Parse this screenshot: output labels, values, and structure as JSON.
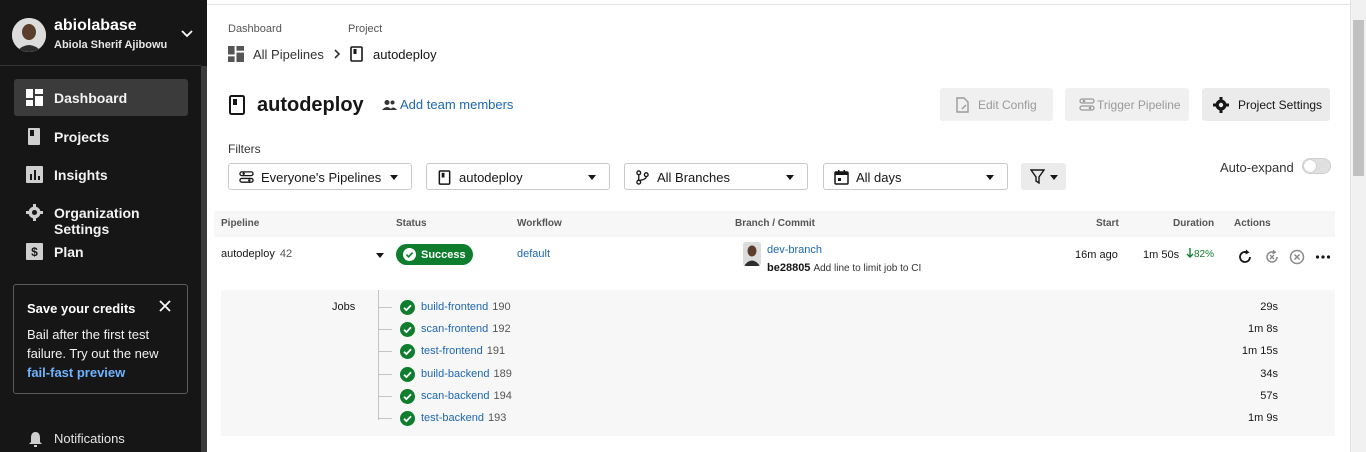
{
  "user": {
    "username": "abiolabase",
    "full_name": "Abiola Sherif Ajibowu"
  },
  "sidebar": {
    "items": [
      {
        "label": "Dashboard",
        "icon": "dashboard-icon",
        "active": true
      },
      {
        "label": "Projects",
        "icon": "projects-icon"
      },
      {
        "label": "Insights",
        "icon": "insights-icon"
      },
      {
        "label": "Organization Settings",
        "icon": "gear-icon"
      },
      {
        "label": "Plan",
        "icon": "plan-icon"
      }
    ],
    "promo": {
      "title": "Save your credits",
      "text": "Bail after the first test failure. Try out the new",
      "link": "fail-fast preview"
    },
    "notifications_label": "Notifications"
  },
  "breadcrumb": {
    "dashboard_label": "Dashboard",
    "dashboard_value": "All Pipelines",
    "project_label": "Project",
    "project_value": "autodeploy"
  },
  "header": {
    "title": "autodeploy",
    "add_team_members": "Add team members",
    "edit_config": "Edit Config",
    "trigger_pipeline": "Trigger Pipeline",
    "project_settings": "Project Settings"
  },
  "filters": {
    "label": "Filters",
    "pipelines": "Everyone's Pipelines",
    "project": "autodeploy",
    "branches": "All Branches",
    "days": "All days",
    "auto_expand": "Auto-expand"
  },
  "table": {
    "headers": {
      "pipeline": "Pipeline",
      "status": "Status",
      "workflow": "Workflow",
      "branch_commit": "Branch / Commit",
      "start": "Start",
      "duration": "Duration",
      "actions": "Actions"
    },
    "row": {
      "pipeline": "autodeploy",
      "number": "42",
      "status": "Success",
      "workflow": "default",
      "branch": "dev-branch",
      "commit_hash": "be28805",
      "commit_msg": "Add line to limit job to CI",
      "start": "16m ago",
      "duration": "1m 50s",
      "delta": "82%"
    },
    "jobs_label": "Jobs",
    "jobs": [
      {
        "name": "build-frontend",
        "num": "190",
        "duration": "29s"
      },
      {
        "name": "scan-frontend",
        "num": "192",
        "duration": "1m 8s"
      },
      {
        "name": "test-frontend",
        "num": "191",
        "duration": "1m 15s"
      },
      {
        "name": "build-backend",
        "num": "189",
        "duration": "34s"
      },
      {
        "name": "scan-backend",
        "num": "194",
        "duration": "57s"
      },
      {
        "name": "test-backend",
        "num": "193",
        "duration": "1m 9s"
      }
    ]
  },
  "colors": {
    "success": "#0e7d2e",
    "link": "#1d67b5",
    "sidebar_bg": "#161616",
    "promo_link": "#6fb3ff"
  }
}
